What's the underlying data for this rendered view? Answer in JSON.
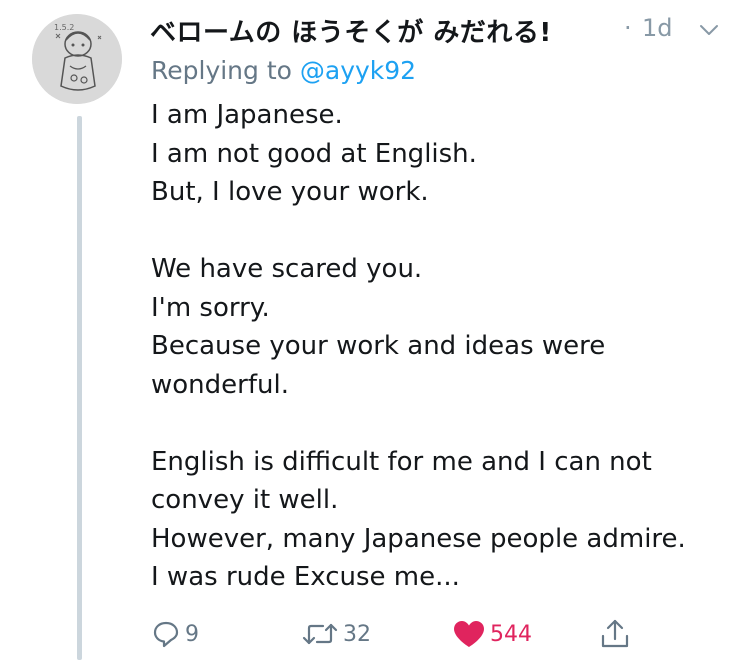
{
  "tweet": {
    "display_name": "ベロームの ほうそくが みだれる!",
    "time_separator": "·",
    "time": "1d",
    "reply_prefix": "Replying to ",
    "reply_handle": "@ayyk92",
    "lines": [
      "I am Japanese.",
      "I am not good at English.",
      "But, I love your work.",
      "",
      "We have scared you.",
      "I'm sorry.",
      "Because your work and ideas were",
      "wonderful.",
      "",
      "English is difficult for me and I can not",
      "convey it well.",
      "However, many Japanese people admire.",
      "I was rude Excuse me..."
    ]
  },
  "actions": {
    "reply_count": "9",
    "retweet_count": "32",
    "like_count": "544"
  },
  "icons": {
    "reply": "reply-icon",
    "retweet": "retweet-icon",
    "like": "heart-icon",
    "share": "share-icon",
    "menu": "chevron-down-icon"
  },
  "colors": {
    "link": "#1da1f2",
    "muted": "#657786",
    "like": "#e0245e",
    "thread_line": "#ccd6dd"
  }
}
